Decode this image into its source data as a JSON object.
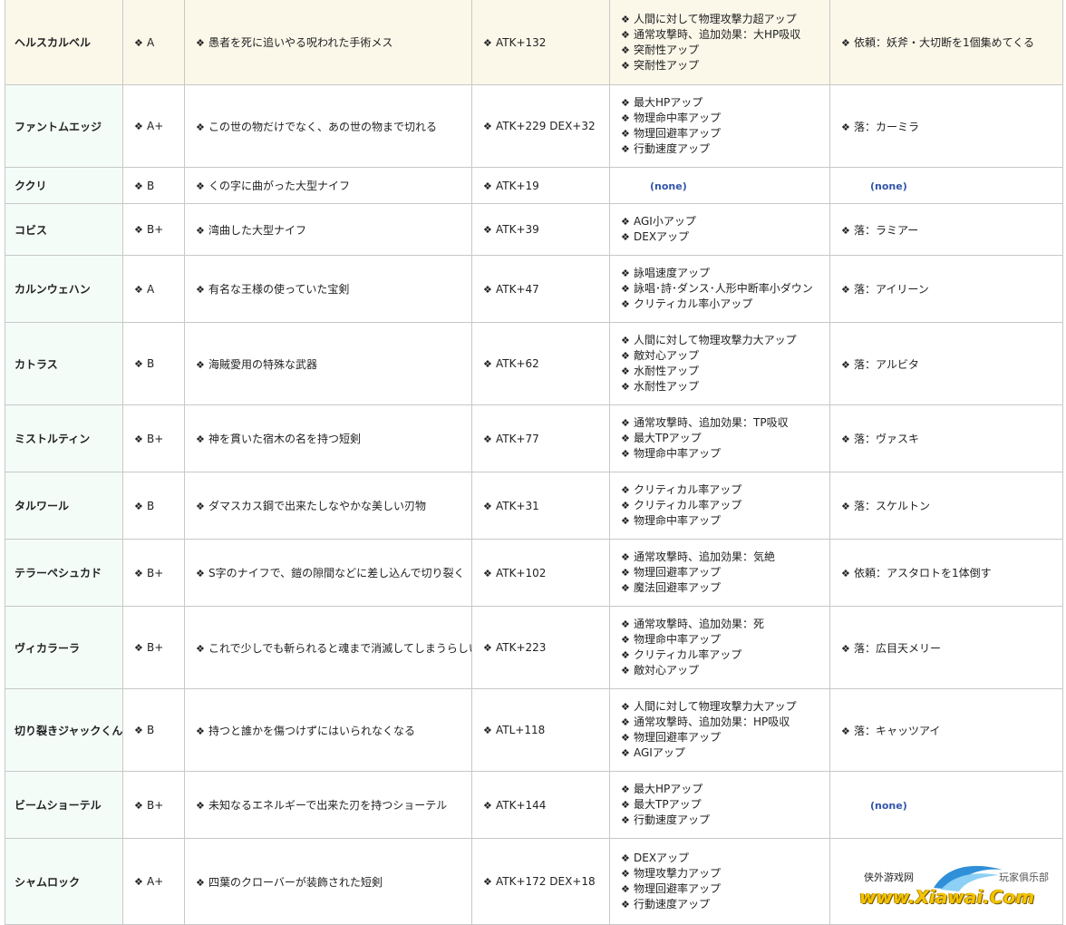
{
  "bullet": "❖",
  "none_label": "(none)",
  "rows": [
    {
      "name": "ヘルスカルベル",
      "rank": "A",
      "desc": "愚者を死に追いやる呪われた手術メス",
      "stat": "ATK+132",
      "effects": [
        "人間に対して物理攻撃力超アップ",
        "通常攻撃時、追加効果：大HP吸収",
        "突耐性アップ",
        "突耐性アップ"
      ],
      "source": "依頼：妖斧・大切断を1個集めてくる"
    },
    {
      "name": "ファントムエッジ",
      "rank": "A+",
      "desc": "この世の物だけでなく、あの世の物まで切れる",
      "stat": "ATK+229 DEX+32",
      "effects": [
        "最大HPアップ",
        "物理命中率アップ",
        "物理回避率アップ",
        "行動速度アップ"
      ],
      "source": "落：カーミラ"
    },
    {
      "name": "ククリ",
      "rank": "B",
      "desc": "くの字に曲がった大型ナイフ",
      "stat": "ATK+19",
      "effects": [],
      "source": ""
    },
    {
      "name": "コビス",
      "rank": "B+",
      "desc": "湾曲した大型ナイフ",
      "stat": "ATK+39",
      "effects": [
        "AGI小アップ",
        "DEXアップ"
      ],
      "source": "落：ラミアー"
    },
    {
      "name": "カルンウェハン",
      "rank": "A",
      "desc": "有名な王様の使っていた宝剣",
      "stat": "ATK+47",
      "effects": [
        "詠唱速度アップ",
        "詠唱･詩･ダンス･人形中断率小ダウン",
        "クリティカル率小アップ"
      ],
      "source": "落：アイリーン"
    },
    {
      "name": "カトラス",
      "rank": "B",
      "desc": "海賊愛用の特殊な武器",
      "stat": "ATK+62",
      "effects": [
        "人間に対して物理攻撃力大アップ",
        "敵対心アップ",
        "水耐性アップ",
        "水耐性アップ"
      ],
      "source": "落：アルビタ"
    },
    {
      "name": "ミストルティン",
      "rank": "B+",
      "desc": "神を貫いた宿木の名を持つ短剣",
      "stat": "ATK+77",
      "effects": [
        "通常攻撃時、追加効果：TP吸収",
        "最大TPアップ",
        "物理命中率アップ"
      ],
      "source": "落：ヴァスキ"
    },
    {
      "name": "タルワール",
      "rank": "B",
      "desc": "ダマスカス鋼で出来たしなやかな美しい刃物",
      "stat": "ATK+31",
      "effects": [
        "クリティカル率アップ",
        "クリティカル率アップ",
        "物理命中率アップ"
      ],
      "source": "落：スケルトン"
    },
    {
      "name": "テラーペシュカド",
      "rank": "B+",
      "desc": "S字のナイフで、鎧の隙間などに差し込んで切り裂く",
      "stat": "ATK+102",
      "effects": [
        "通常攻撃時、追加効果：気絶",
        "物理回避率アップ",
        "魔法回避率アップ"
      ],
      "source": "依頼：アスタロトを1体倒す"
    },
    {
      "name": "ヴィカラーラ",
      "rank": "B+",
      "desc": "これで少しでも斬られると魂まで消滅してしまうらしい",
      "stat": "ATK+223",
      "effects": [
        "通常攻撃時、追加効果：死",
        "物理命中率アップ",
        "クリティカル率アップ",
        "敵対心アップ"
      ],
      "source": "落：広目天メリー"
    },
    {
      "name": "切り裂きジャックくん",
      "rank": "B",
      "desc": "持つと誰かを傷つけずにはいられなくなる",
      "stat": "ATL+118",
      "effects": [
        "人間に対して物理攻撃力大アップ",
        "通常攻撃時、追加効果：HP吸収",
        "物理回避率アップ",
        "AGIアップ"
      ],
      "source": "落：キャッツアイ"
    },
    {
      "name": "ビームショーテル",
      "rank": "B+",
      "desc": "未知なるエネルギーで出来た刃を持つショーテル",
      "stat": "ATK+144",
      "effects": [
        "最大HPアップ",
        "最大TPアップ",
        "行動速度アップ"
      ],
      "source": ""
    },
    {
      "name": "シャムロック",
      "rank": "A+",
      "desc": "四葉のクローバーが装飾された短剣",
      "stat": "ATK+172 DEX+18",
      "effects": [
        "DEXアップ",
        "物理攻撃力アップ",
        "物理回避率アップ",
        "行動速度アップ"
      ],
      "source": ""
    }
  ],
  "watermark": {
    "site": "侠外游戏网",
    "club": "玩家俱乐部",
    "url": "www.Xiawai.Com"
  }
}
